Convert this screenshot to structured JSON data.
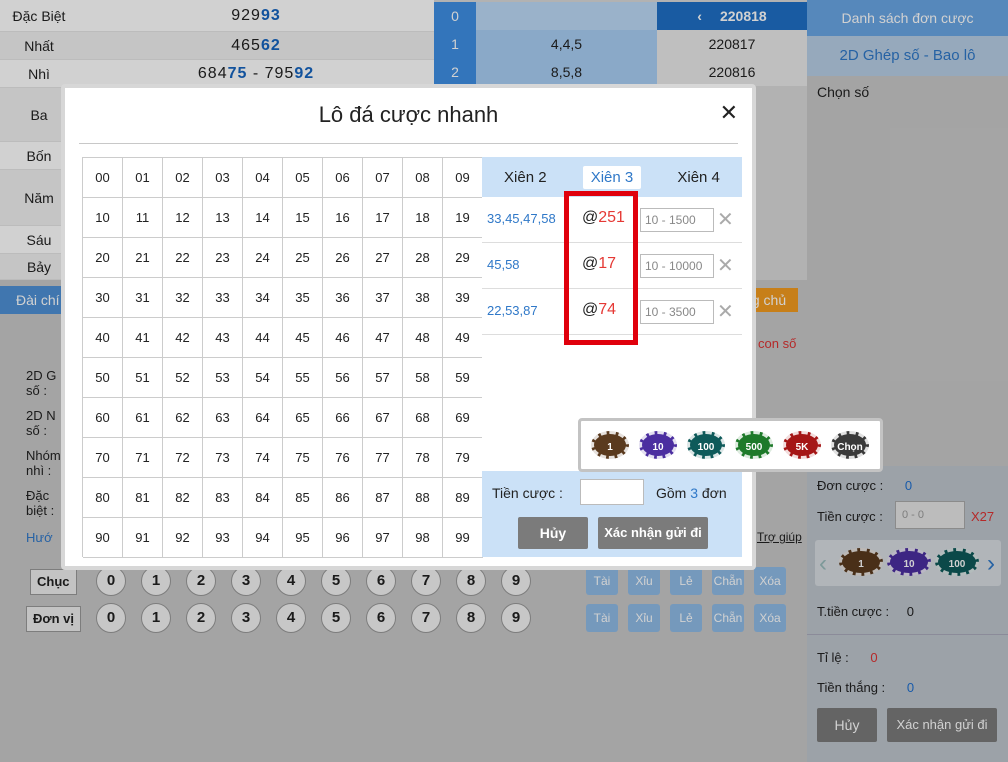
{
  "results": [
    {
      "label": "Đặc Biệt",
      "pre": "929",
      "bold": "93"
    },
    {
      "label": "Nhất",
      "pre": "465",
      "bold": "62"
    },
    {
      "label": "Nhì",
      "pre": "684",
      "bold": "75",
      "sep": " - ",
      "pre2": "795",
      "bold2": "92"
    },
    {
      "label": "Ba"
    },
    {
      "label": "Bốn"
    },
    {
      "label": "Năm"
    },
    {
      "label": "Sáu"
    },
    {
      "label": "Bảy"
    }
  ],
  "draws": [
    {
      "index": "0",
      "value": "",
      "code": "220818",
      "prev": "‹"
    },
    {
      "index": "1",
      "value": "4,4,5",
      "code": "220817"
    },
    {
      "index": "2",
      "value": "8,5,8",
      "code": "220816"
    }
  ],
  "bg_labels": {
    "dai_chinh": "Đài chí",
    "chu": "g chủ",
    "con_so": "con số",
    "left_fields": [
      "2D G số :",
      "2D N số :",
      "Nhóm nhì :",
      "Đặc biệt :"
    ],
    "huong": "Hướ",
    "tro_giup": "Trợ giúp",
    "chuc": "Chục",
    "don_vi": "Đơn vị",
    "digits": [
      "0",
      "1",
      "2",
      "3",
      "4",
      "5",
      "6",
      "7",
      "8",
      "9"
    ],
    "quick": [
      "Tài",
      "Xỉu",
      "Lẻ",
      "Chẵn",
      "Xóa"
    ]
  },
  "right_panel": {
    "header": "Danh sách đơn cược",
    "subheader": "2D Ghép số - Bao lô",
    "choose": "Chọn số",
    "don_cuoc_label": "Đơn cược :",
    "don_cuoc_value": "0",
    "tien_cuoc_label": "Tiền cược :",
    "tien_cuoc_placeholder": "0 - 0",
    "multiplier": "X27",
    "chips": [
      "1",
      "10",
      "100"
    ],
    "t_tien_cuoc_label": "T.tiền cược :",
    "t_tien_cuoc_value": "0",
    "ti_le_label": "Tỉ lệ :",
    "ti_le_value": "0",
    "tien_thang_label": "Tiền thắng :",
    "tien_thang_value": "0",
    "cancel": "Hủy",
    "confirm": "Xác nhận gửi đi"
  },
  "modal": {
    "title": "Lô đá cược nhanh",
    "close": "✕",
    "numbers": [
      "00",
      "01",
      "02",
      "03",
      "04",
      "05",
      "06",
      "07",
      "08",
      "09",
      "10",
      "11",
      "12",
      "13",
      "14",
      "15",
      "16",
      "17",
      "18",
      "19",
      "20",
      "21",
      "22",
      "23",
      "24",
      "25",
      "26",
      "27",
      "28",
      "29",
      "30",
      "31",
      "32",
      "33",
      "34",
      "35",
      "36",
      "37",
      "38",
      "39",
      "40",
      "41",
      "42",
      "43",
      "44",
      "45",
      "46",
      "47",
      "48",
      "49",
      "50",
      "51",
      "52",
      "53",
      "54",
      "55",
      "56",
      "57",
      "58",
      "59",
      "60",
      "61",
      "62",
      "63",
      "64",
      "65",
      "66",
      "67",
      "68",
      "69",
      "70",
      "71",
      "72",
      "73",
      "74",
      "75",
      "76",
      "77",
      "78",
      "79",
      "80",
      "81",
      "82",
      "83",
      "84",
      "85",
      "86",
      "87",
      "88",
      "89",
      "90",
      "91",
      "92",
      "93",
      "94",
      "95",
      "96",
      "97",
      "98",
      "99"
    ],
    "tabs": [
      "Xiên 2",
      "Xiên 3",
      "Xiên 4"
    ],
    "active_tab": "Xiên 3",
    "rows": [
      {
        "nums": "33,45,47,58",
        "odds": "251",
        "range": "10 - 1500"
      },
      {
        "nums": "45,58",
        "odds": "17",
        "range": "10 - 10000"
      },
      {
        "nums": "22,53,87",
        "odds": "74",
        "range": "10 - 3500"
      }
    ],
    "tien_cuoc_label": "Tiền cược :",
    "gom_label": "Gồm",
    "gom_value": "3",
    "don_label": "đơn",
    "cancel": "Hủy",
    "confirm": "Xác nhận gửi đi",
    "chips": [
      {
        "label": "1",
        "color": "#5a3a1e"
      },
      {
        "label": "10",
        "color": "#4b2ea0"
      },
      {
        "label": "100",
        "color": "#0e5a5a"
      },
      {
        "label": "500",
        "color": "#1e7a2a"
      },
      {
        "label": "5K",
        "color": "#a51616"
      },
      {
        "label": "Chọn",
        "color": "#3a3a3a"
      }
    ]
  }
}
